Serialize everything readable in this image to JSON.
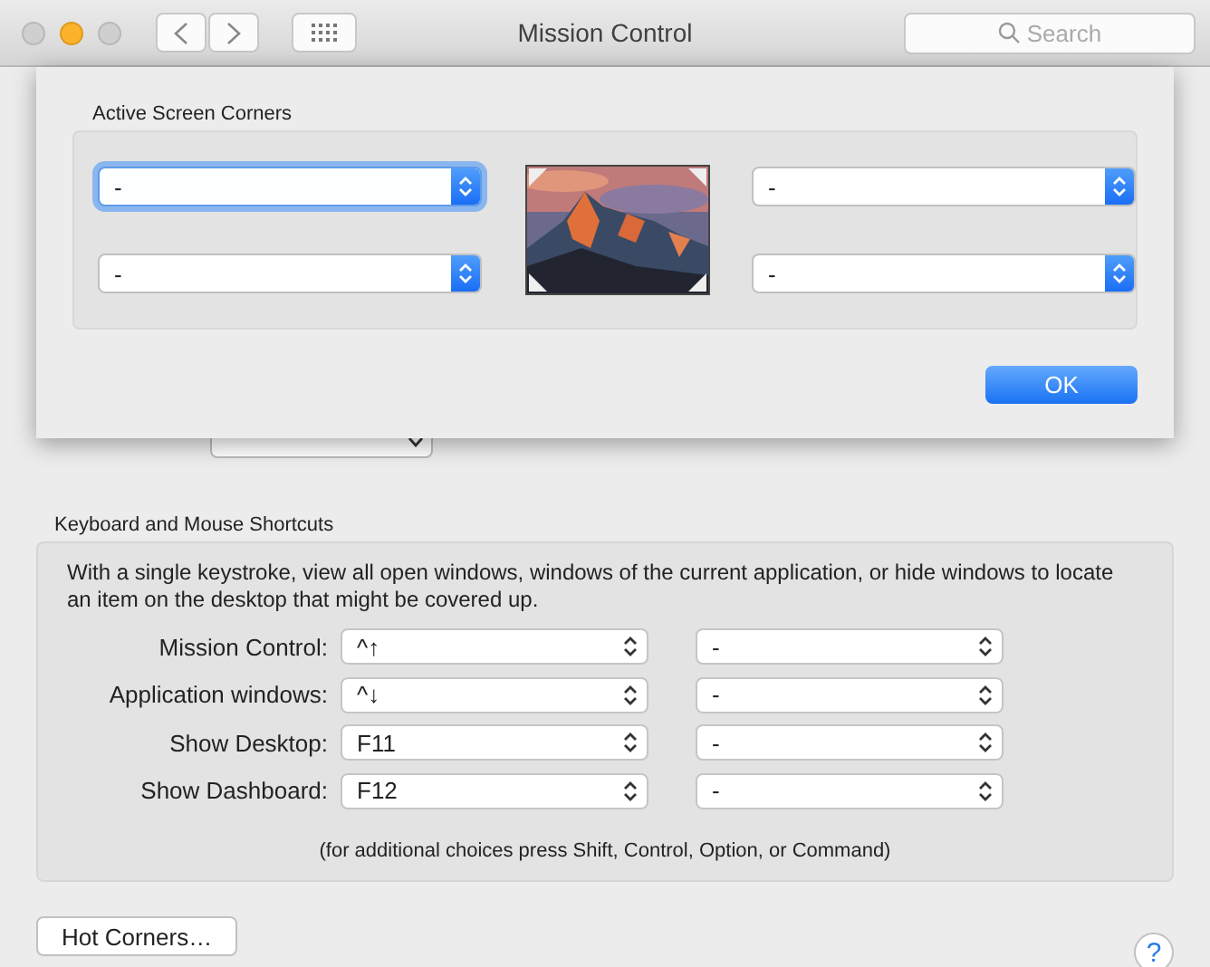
{
  "window": {
    "title": "Mission Control",
    "search": {
      "placeholder": "Search"
    }
  },
  "sheet": {
    "title": "Active Screen Corners",
    "corners": [
      {
        "value": "-",
        "focused": true
      },
      {
        "value": "-",
        "focused": false
      },
      {
        "value": "-",
        "focused": false
      },
      {
        "value": "-",
        "focused": false
      }
    ],
    "ok": "OK"
  },
  "shortcuts": {
    "title": "Keyboard and Mouse Shortcuts",
    "description": "With a single keystroke, view all open windows, windows of the current application, or hide windows to locate an item on the desktop that might be covered up.",
    "rows": [
      {
        "label": "Mission Control:",
        "keyboard": "^↑",
        "mouse": "-"
      },
      {
        "label": "Application windows:",
        "keyboard": "^↓",
        "mouse": "-"
      },
      {
        "label": "Show Desktop:",
        "keyboard": "F11",
        "mouse": "-"
      },
      {
        "label": "Show Dashboard:",
        "keyboard": "F12",
        "mouse": "-"
      }
    ],
    "hint": "(for additional choices press Shift, Control, Option, or Command)"
  },
  "hot_corners_button": "Hot Corners…",
  "help": "?"
}
